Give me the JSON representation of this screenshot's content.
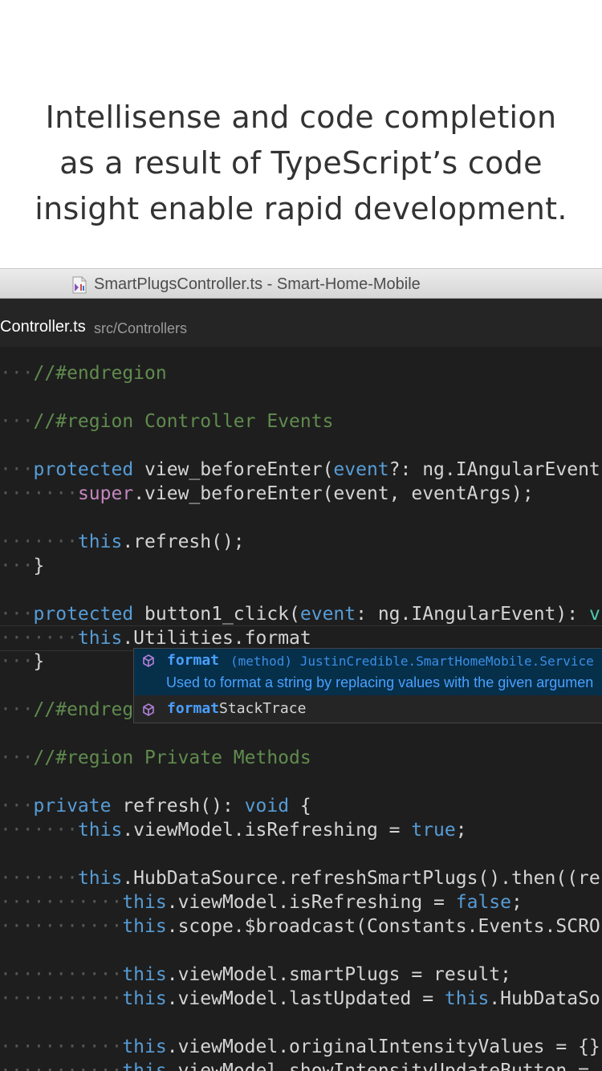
{
  "caption": {
    "line1": "Intellisense and code completion",
    "line2": "as a result of TypeScript’s code",
    "line3": "insight enable rapid development."
  },
  "window": {
    "title": "SmartPlugsController.ts - Smart-Home-Mobile",
    "file_icon": "typescript-file-icon"
  },
  "tab": {
    "name": "Controller.ts",
    "path": "src/Controllers"
  },
  "colors": {
    "editor_bg": "#1e1e1e",
    "comment": "#608b4e",
    "keyword": "#569cd6",
    "type": "#4ec9b0",
    "suggest_selected": "#062f4a",
    "suggest_match": "#4aa0ff"
  },
  "code": {
    "l1": "//#endregion",
    "l2": "//#region Controller Events",
    "l3_kw": "protected",
    "l3_rest": " view_beforeEnter(",
    "l3_param": "event",
    "l3_tail": "?: ng.IAngularEvent",
    "l4_kw": "super",
    "l4_rest": ".view_beforeEnter(event, eventArgs);",
    "l5_kw": "this",
    "l5_rest": ".refresh();",
    "l6": "}",
    "l7_kw": "protected",
    "l7_rest": " button1_click(",
    "l7_param": "event",
    "l7_tail": ": ng.IAngularEvent): ",
    "l7_end": "v",
    "l8_kw": "this",
    "l8_rest": ".Utilities.format",
    "l9": "}",
    "l10": "//#endregion",
    "l11": "//#region Private Methods",
    "l12_kw": "private",
    "l12_rest": " refresh(): ",
    "l12_ty": "void",
    "l12_tail": " {",
    "l13_kw": "this",
    "l13_rest": ".viewModel.isRefreshing = ",
    "l13_lit": "true",
    "l13_tail": ";",
    "l14_kw": "this",
    "l14_rest": ".HubDataSource.refreshSmartPlugs().then((re",
    "l15_kw": "this",
    "l15_rest": ".viewModel.isRefreshing = ",
    "l15_lit": "false",
    "l15_tail": ";",
    "l16_kw": "this",
    "l16_rest": ".scope.$broadcast(Constants.Events.SCRO",
    "l17_kw": "this",
    "l17_rest": ".viewModel.smartPlugs = result;",
    "l18_kw": "this",
    "l18_rest": ".viewModel.lastUpdated = ",
    "l18_kw2": "this",
    "l18_tail": ".HubDataSo",
    "l19_kw": "this",
    "l19_rest": ".viewModel.originalIntensityValues = {}",
    "l20_kw": "this",
    "l20_rest": ".viewModel.showIntensityUpdateButton = "
  },
  "suggest": {
    "item1_label": "format",
    "item1_type": "(method) JustinCredible.SmartHomeMobile.Service",
    "item1_doc": "Used to format a string by replacing values with the given argumen",
    "item2_match": "format",
    "item2_rest": "StackTrace",
    "icon": "method-cube-icon"
  }
}
